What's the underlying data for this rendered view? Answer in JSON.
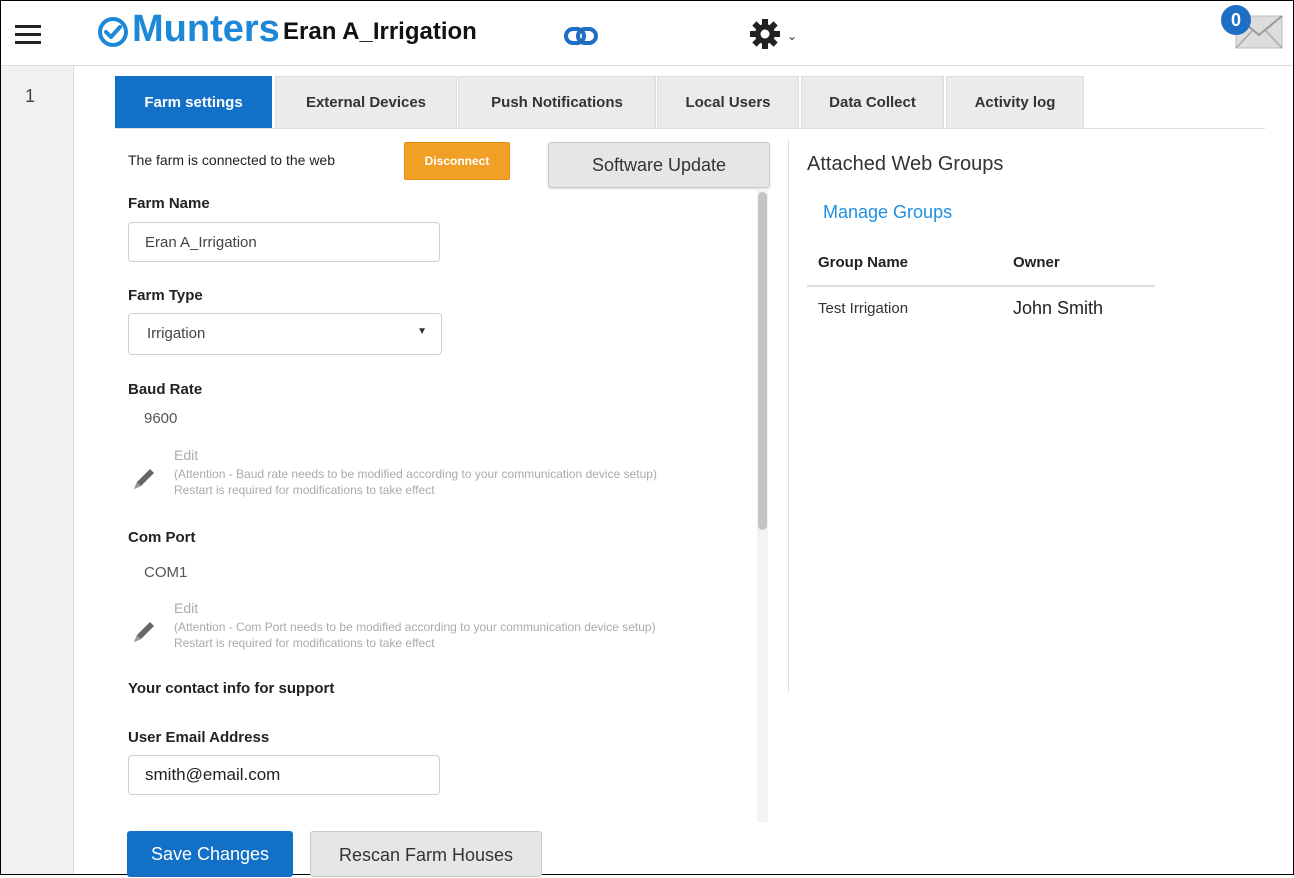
{
  "header": {
    "brand": "Munters",
    "farm_title": "Eran A_Irrigation",
    "mail_count": "0"
  },
  "rail": {
    "index": "1"
  },
  "tabs": [
    {
      "label": "Farm settings"
    },
    {
      "label": "External Devices"
    },
    {
      "label": "Push Notifications"
    },
    {
      "label": "Local Users"
    },
    {
      "label": "Data Collect"
    },
    {
      "label": "Activity log"
    }
  ],
  "settings": {
    "connection_text": "The farm is connected to the web",
    "disconnect_label": "Disconnect",
    "software_update_label": "Software Update",
    "farm_name_label": "Farm Name",
    "farm_name_value": "Eran A_Irrigation",
    "farm_type_label": "Farm Type",
    "farm_type_value": "Irrigation",
    "baud_rate_label": "Baud Rate",
    "baud_rate_value": "9600",
    "baud_edit_label": "Edit",
    "baud_note_1": "(Attention - Baud rate needs to be modified according to your communication device setup)",
    "baud_note_2": "Restart is required for modifications to take effect",
    "com_port_label": "Com Port",
    "com_port_value": "COM1",
    "com_edit_label": "Edit",
    "com_note_1": "(Attention - Com Port needs to be modified according to your communication device setup)",
    "com_note_2": "Restart is required for modifications to take effect",
    "contact_heading": "Your contact info for support",
    "email_label": "User Email Address",
    "email_value": "smith@email.com",
    "save_label": "Save Changes",
    "rescan_label": "Rescan Farm Houses"
  },
  "web_groups": {
    "title": "Attached Web Groups",
    "manage_label": "Manage Groups",
    "columns": [
      "Group Name",
      "Owner"
    ],
    "rows": [
      [
        "Test Irrigation",
        "John Smith"
      ]
    ]
  },
  "colors": {
    "brand_blue": "#1e88d8",
    "tab_active": "#1270c7",
    "disconnect_orange": "#f1a025",
    "link_blue": "#1e90e0"
  }
}
